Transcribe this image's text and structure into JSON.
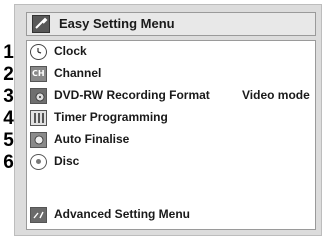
{
  "header": {
    "title": "Easy Setting Menu",
    "icon": "wrench-icon"
  },
  "menu": {
    "items": [
      {
        "number": "1",
        "label": "Clock",
        "value": "",
        "icon": "clock-icon"
      },
      {
        "number": "2",
        "label": "Channel",
        "value": "",
        "icon": "channel-icon"
      },
      {
        "number": "3",
        "label": "DVD-RW Recording Format",
        "value": "Video mode",
        "icon": "dvd-rw-icon"
      },
      {
        "number": "4",
        "label": "Timer Programming",
        "value": "",
        "icon": "timer-icon"
      },
      {
        "number": "5",
        "label": "Auto Finalise",
        "value": "",
        "icon": "finalise-icon"
      },
      {
        "number": "6",
        "label": "Disc",
        "value": "",
        "icon": "disc-icon"
      }
    ],
    "advanced": {
      "label": "Advanced Setting Menu",
      "icon": "advanced-settings-icon"
    }
  },
  "colors": {
    "panel": "#dcdcdc",
    "menu_bg": "#ffffff",
    "text": "#1a1a1a"
  }
}
